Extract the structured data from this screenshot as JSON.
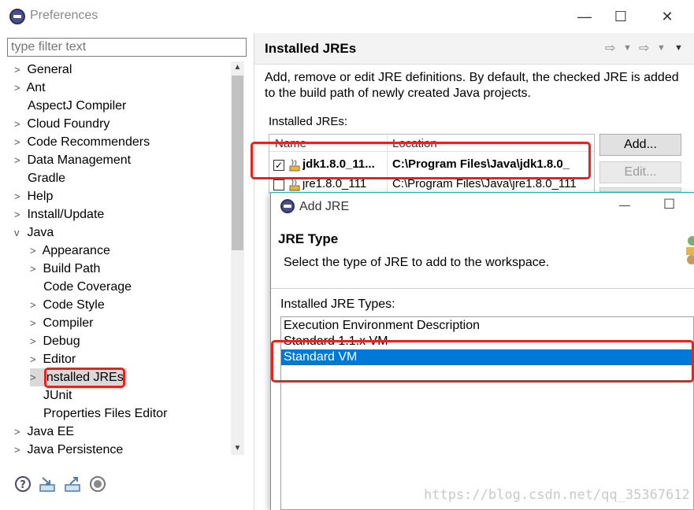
{
  "window": {
    "title": "Preferences",
    "minimize": "—",
    "maximize": "☐",
    "close": "✕"
  },
  "filter": {
    "placeholder": "type filter text"
  },
  "tree": [
    {
      "label": "General",
      "chev": ">"
    },
    {
      "label": "Ant",
      "chev": ">"
    },
    {
      "label": "AspectJ Compiler",
      "chev": ""
    },
    {
      "label": "Cloud Foundry",
      "chev": ">"
    },
    {
      "label": "Code Recommenders",
      "chev": ">"
    },
    {
      "label": "Data Management",
      "chev": ">"
    },
    {
      "label": "Gradle",
      "chev": ""
    },
    {
      "label": "Help",
      "chev": ">"
    },
    {
      "label": "Install/Update",
      "chev": ">"
    },
    {
      "label": "Java",
      "chev": "v"
    },
    {
      "label": "Appearance",
      "chev": ">"
    },
    {
      "label": "Build Path",
      "chev": ">"
    },
    {
      "label": "Code Coverage",
      "chev": ""
    },
    {
      "label": "Code Style",
      "chev": ">"
    },
    {
      "label": "Compiler",
      "chev": ">"
    },
    {
      "label": "Debug",
      "chev": ">"
    },
    {
      "label": "Editor",
      "chev": ">"
    },
    {
      "label": "Installed JREs",
      "chev": ">"
    },
    {
      "label": "JUnit",
      "chev": ""
    },
    {
      "label": "Properties Files Editor",
      "chev": ""
    },
    {
      "label": "Java EE",
      "chev": ">"
    },
    {
      "label": "Java Persistence",
      "chev": ">"
    }
  ],
  "right": {
    "title": "Installed JREs",
    "description": "Add, remove or edit JRE definitions. By default, the checked JRE is added to the build path of newly created Java projects.",
    "table_label": "Installed JREs:",
    "columns": [
      "Name",
      "Location"
    ],
    "rows": [
      {
        "name": "jdk1.8.0_11...",
        "location": "C:\\Program Files\\Java\\jdk1.8.0_",
        "checked": true
      },
      {
        "name": "jre1.8.0_111",
        "location": "C:\\Program Files\\Java\\jre1.8.0_111",
        "checked": false
      }
    ],
    "buttons": {
      "add": "Add...",
      "edit": "Edit..."
    }
  },
  "dialog": {
    "title": "Add JRE",
    "minimize": "—",
    "maximize": "☐",
    "section_title": "JRE Type",
    "section_desc": "Select the type of JRE to add to the workspace.",
    "types_label": "Installed JRE Types:",
    "types": [
      "Execution Environment Description",
      "Standard 1.1.x VM",
      "Standard VM"
    ],
    "selected_index": 2
  },
  "watermark": "https://blog.csdn.net/qq_35367612",
  "icons": [
    "help-icon",
    "import-icon",
    "export-icon",
    "oomph-icon",
    "back-icon",
    "forward-icon",
    "eclipse-icon",
    "jre-icon"
  ],
  "colors": {
    "selection": "#0078d7",
    "highlight": "#e8231f"
  }
}
